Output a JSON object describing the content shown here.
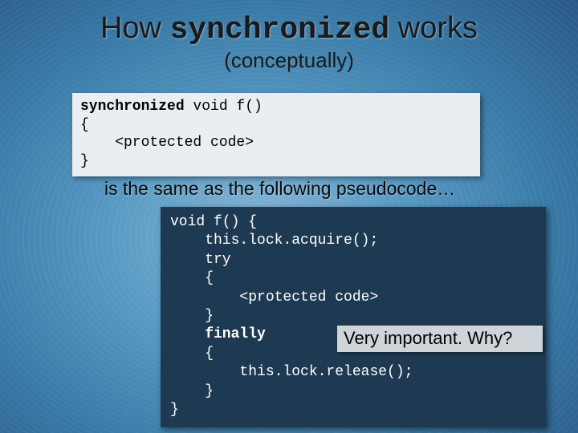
{
  "title": {
    "pre": "How ",
    "kw": "synchronized",
    "post": " works"
  },
  "subtitle": "(conceptually)",
  "code1": {
    "l1a": "synchronized",
    "l1b": " void f()",
    "l2": "{",
    "l3": "    <protected code>",
    "l4": "}"
  },
  "midline": "is the same as the following pseudocode…",
  "code2": {
    "l1": "void f() {",
    "l2": "    this.lock.acquire();",
    "l3": "    try",
    "l4": "    {",
    "l5": "        <protected code>",
    "l6": "    }",
    "l7": "    finally",
    "l8": "    {",
    "l9": "        this.lock.release();",
    "l10": "    }",
    "l11": "}"
  },
  "callout": "Very important.  Why?"
}
